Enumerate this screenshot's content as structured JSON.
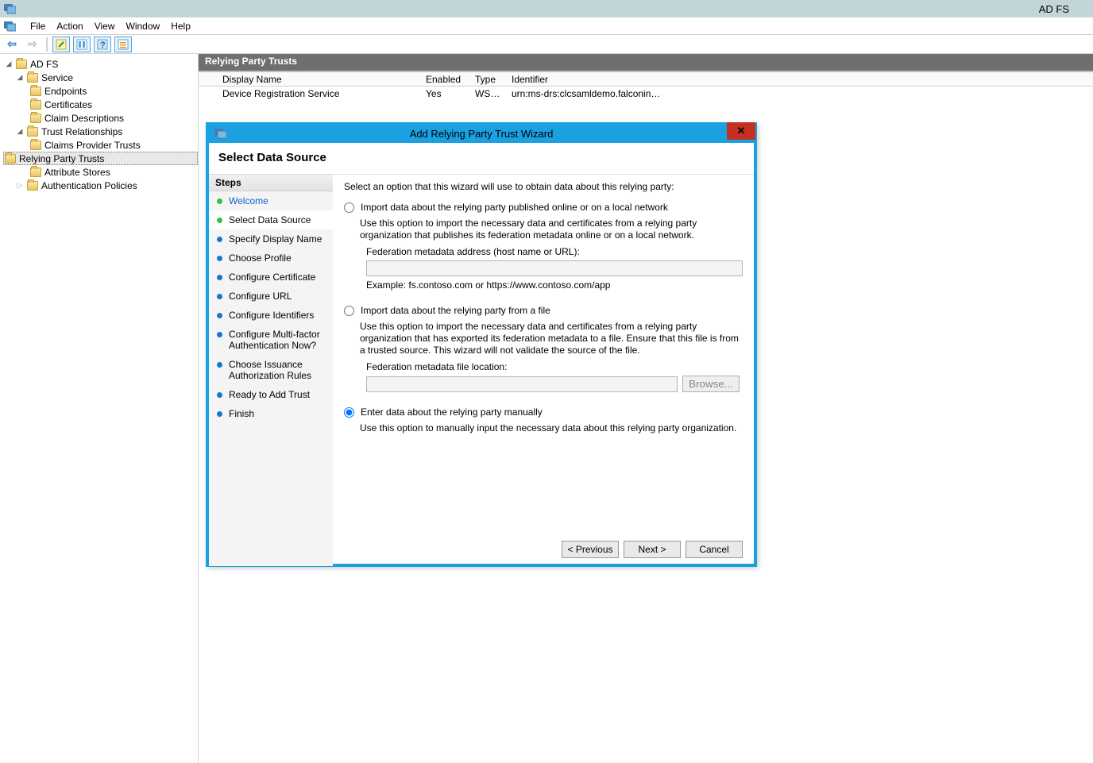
{
  "window": {
    "title": "AD FS"
  },
  "menubar": {
    "file": "File",
    "action": "Action",
    "view": "View",
    "window": "Window",
    "help": "Help"
  },
  "tree": {
    "root": "AD FS",
    "service": "Service",
    "endpoints": "Endpoints",
    "certificates": "Certificates",
    "claim_descriptions": "Claim Descriptions",
    "trust_relationships": "Trust Relationships",
    "claims_provider": "Claims Provider Trusts",
    "relying_party": "Relying Party Trusts",
    "attribute_stores": "Attribute Stores",
    "auth_policies": "Authentication Policies"
  },
  "panel": {
    "header": "Relying Party Trusts",
    "columns": {
      "display": "Display Name",
      "enabled": "Enabled",
      "type": "Type",
      "identifier": "Identifier"
    },
    "row": {
      "display": "Device Registration Service",
      "enabled": "Yes",
      "type": "WS-T...",
      "identifier": "urn:ms-drs:clcsamldemo.falconinfosec..."
    }
  },
  "wizard": {
    "title": "Add Relying Party Trust Wizard",
    "heading": "Select Data Source",
    "steps_title": "Steps",
    "steps": {
      "welcome": "Welcome",
      "select_ds": "Select Data Source",
      "display_name": "Specify Display Name",
      "profile": "Choose Profile",
      "cert": "Configure Certificate",
      "url": "Configure URL",
      "ids": "Configure Identifiers",
      "mfa": "Configure Multi-factor Authentication Now?",
      "issuance": "Choose Issuance Authorization Rules",
      "ready": "Ready to Add Trust",
      "finish": "Finish"
    },
    "intro": "Select an option that this wizard will use to obtain data about this relying party:",
    "opt1": {
      "label": "Import data about the relying party published online or on a local network",
      "desc": "Use this option to import the necessary data and certificates from a relying party organization that publishes its federation metadata online or on a local network.",
      "field": "Federation metadata address (host name or URL):",
      "example": "Example: fs.contoso.com or https://www.contoso.com/app"
    },
    "opt2": {
      "label": "Import data about the relying party from a file",
      "desc": "Use this option to import the necessary data and certificates from a relying party organization that has exported its federation metadata to a file. Ensure that this file is from a trusted source.  This wizard will not validate the source of the file.",
      "field": "Federation metadata file location:",
      "browse": "Browse..."
    },
    "opt3": {
      "label": "Enter data about the relying party manually",
      "desc": "Use this option to manually input the necessary data about this relying party organization."
    },
    "buttons": {
      "prev": "< Previous",
      "next": "Next >",
      "cancel": "Cancel"
    }
  }
}
